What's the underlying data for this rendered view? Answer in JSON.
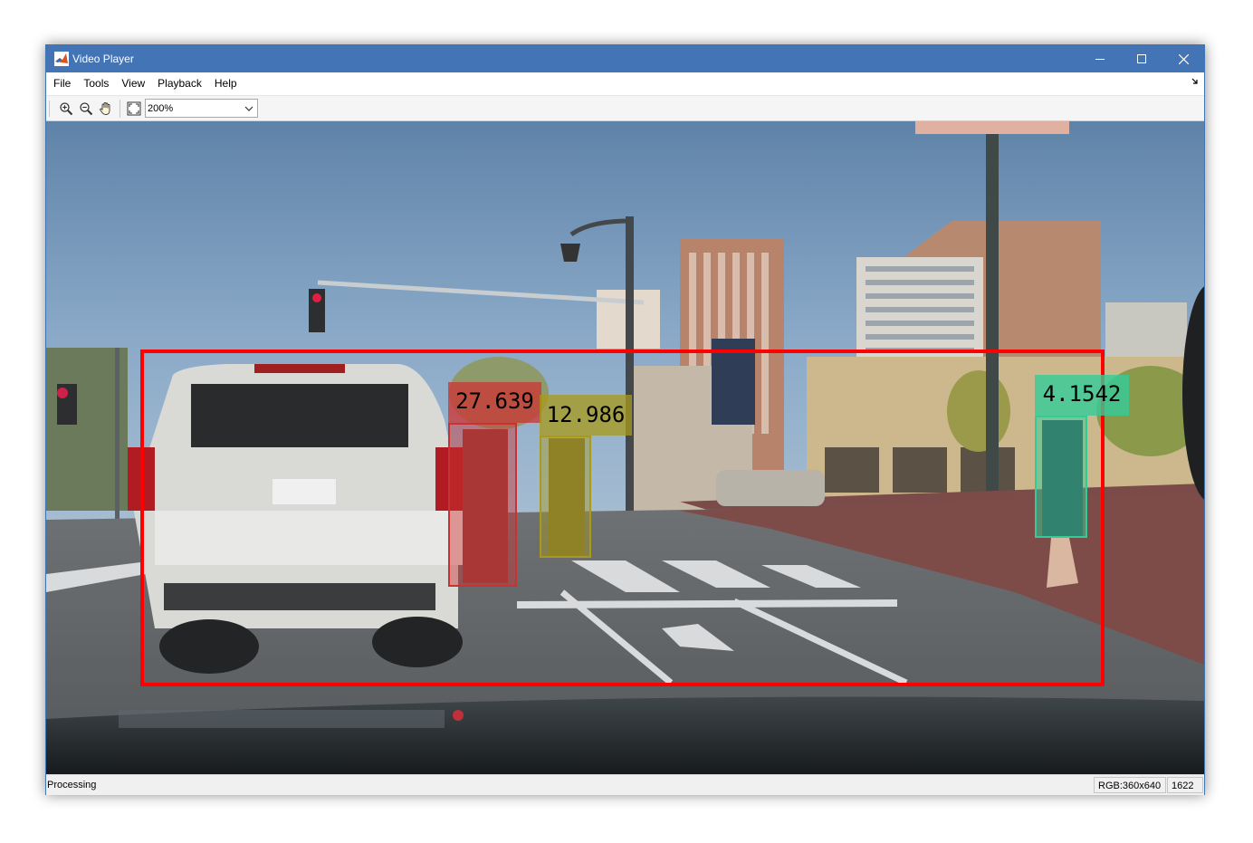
{
  "window": {
    "title": "Video Player",
    "controls": [
      "minimize-icon",
      "maximize-icon",
      "close-icon"
    ]
  },
  "menu": {
    "items": [
      "File",
      "Tools",
      "View",
      "Playback",
      "Help"
    ],
    "undock_icon": "undock-icon"
  },
  "toolbar": {
    "buttons": [
      "zoom-in-icon",
      "zoom-out-icon",
      "pan-hand-icon",
      "fit-to-window-icon"
    ],
    "zoom_value": "200%"
  },
  "video": {
    "roi_color": "#ff0000",
    "detections": [
      {
        "label": "27.639",
        "color": "#cc3333"
      },
      {
        "label": "12.986",
        "color": "#a89a1a"
      },
      {
        "label": "4.1542",
        "color": "#33cc99"
      }
    ]
  },
  "status": {
    "text": "Processing",
    "image_info": "RGB:360x640",
    "frame": "1622"
  },
  "colors": {
    "titlebar": "#4274b6",
    "menubar": "#ffffff",
    "statusbar": "#f0f0f0"
  }
}
